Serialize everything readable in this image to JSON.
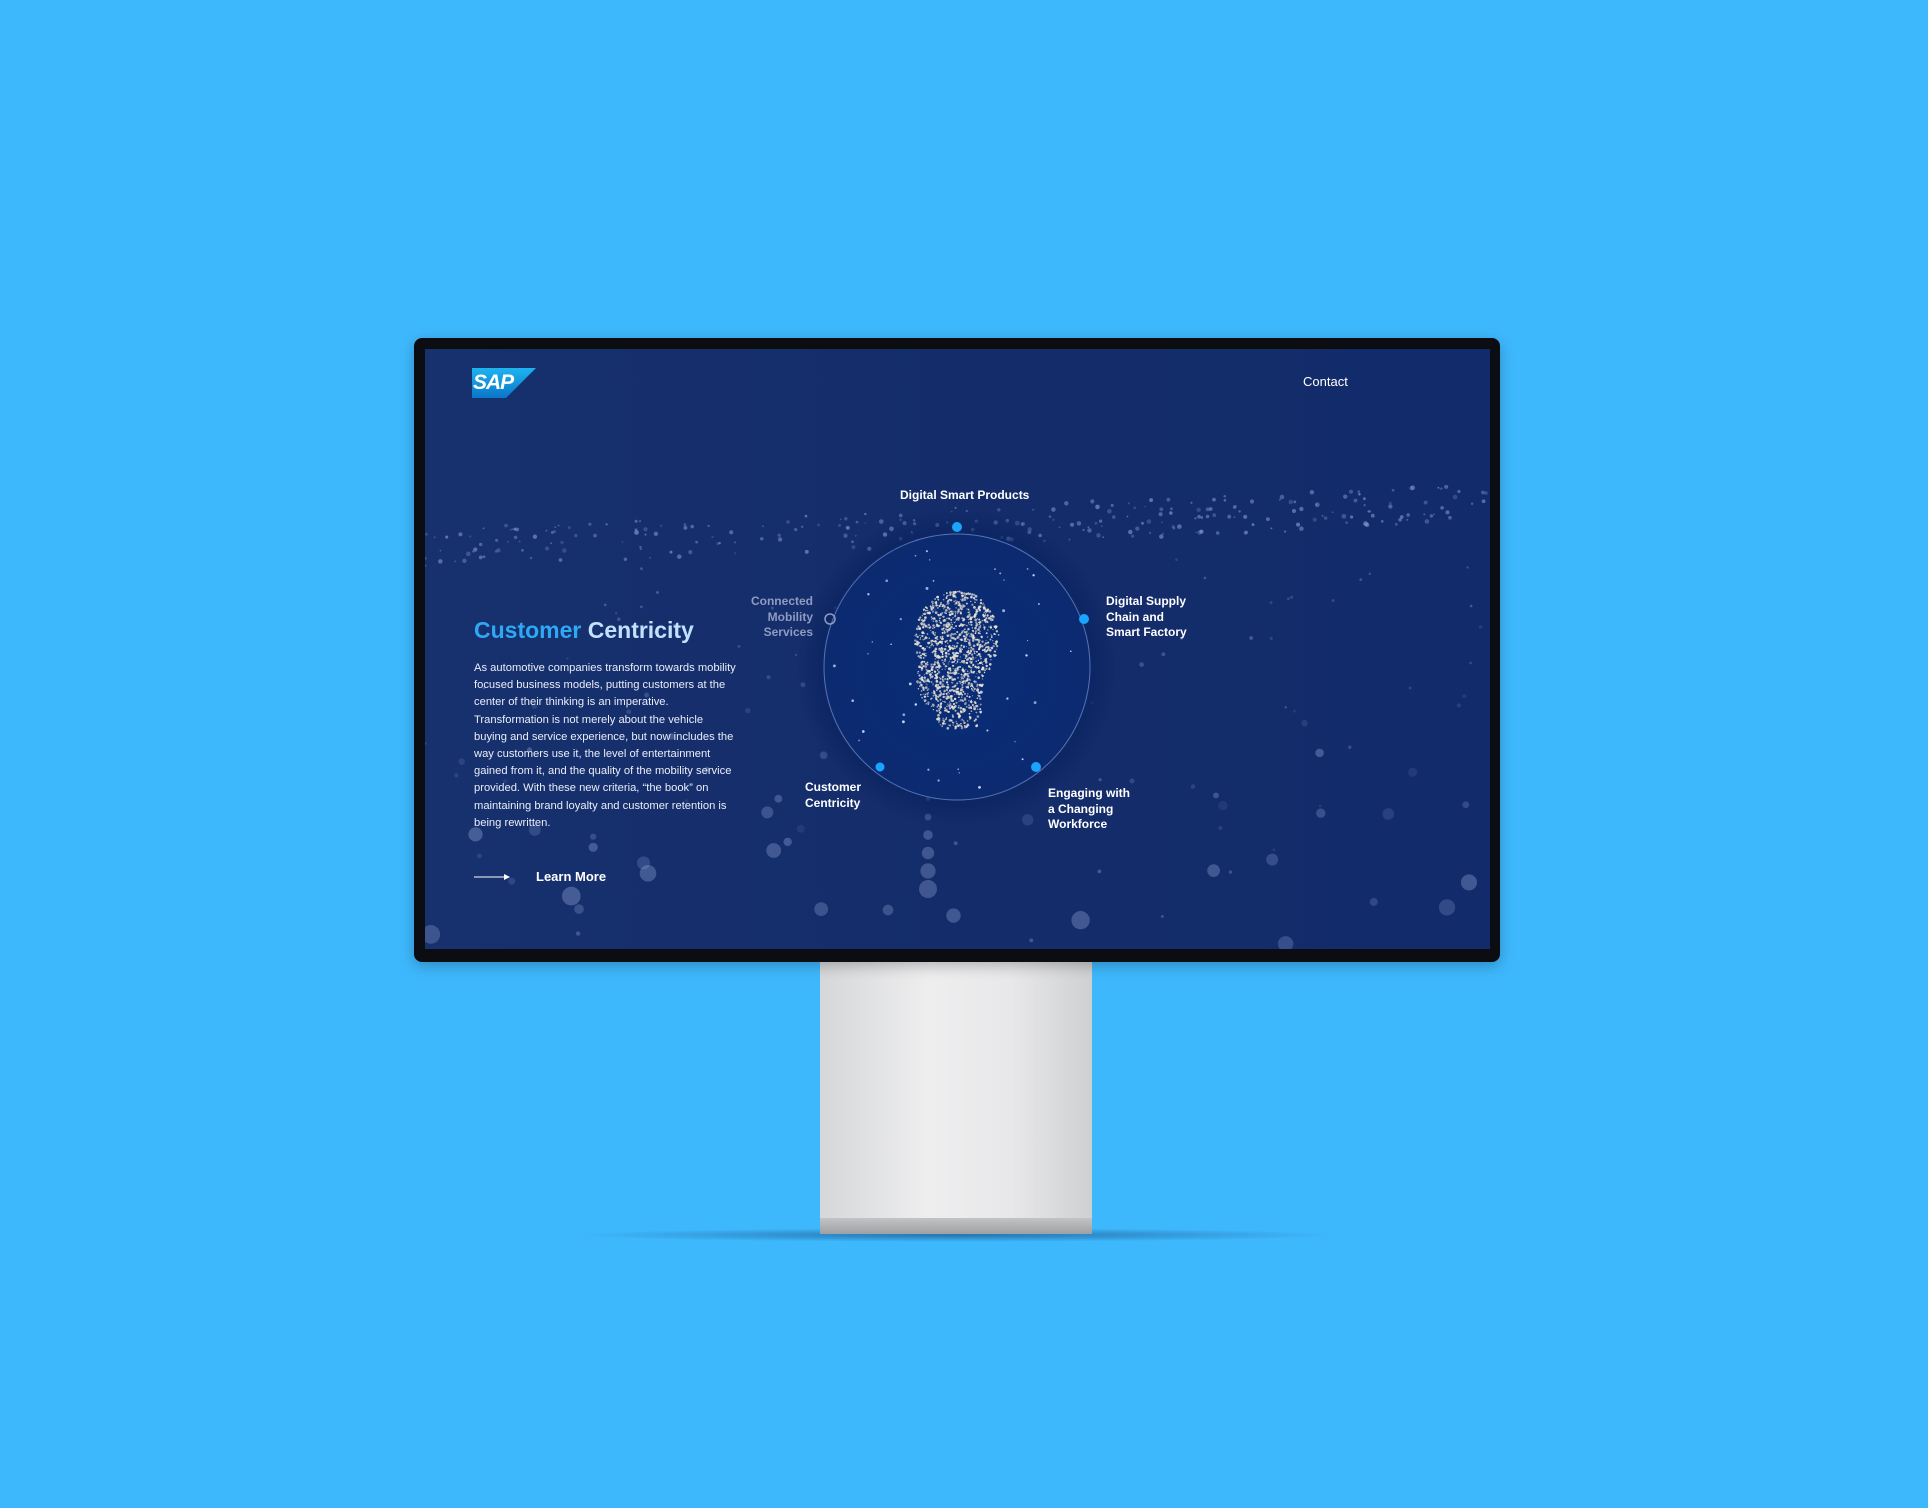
{
  "header": {
    "logo_text": "SAP",
    "contact_label": "Contact"
  },
  "hero": {
    "title_word1": "Customer",
    "title_word2": "Centricity",
    "body": "As automotive companies transform towards mobility focused business models, putting customers at the center of their thinking is an imperative. Transformation is not merely about the vehicle buying and service experience, but now includes the way customers use it, the level of entertainment gained from it, and the quality of the mobility service provided. With these new criteria, “the book” on maintaining brand loyalty and customer retention is being rewritten.",
    "cta_label": "Learn More",
    "cta_icon": "arrow-right-icon"
  },
  "nodes": {
    "top": "Digital Smart Products",
    "left": [
      "Connected",
      "Mobility",
      "Services"
    ],
    "right": [
      "Digital Supply",
      "Chain and",
      "Smart Factory"
    ],
    "bottom_left": [
      "Customer",
      "Centricity"
    ],
    "bottom_right": [
      "Engaging with",
      "a Changing",
      "Workforce"
    ]
  },
  "colors": {
    "page_background": "#3eb8fd",
    "screen_background": "#17306e",
    "accent": "#2ea8f5",
    "node_active": "#1aa3ff",
    "node_inactive": "#8f9bc0"
  }
}
